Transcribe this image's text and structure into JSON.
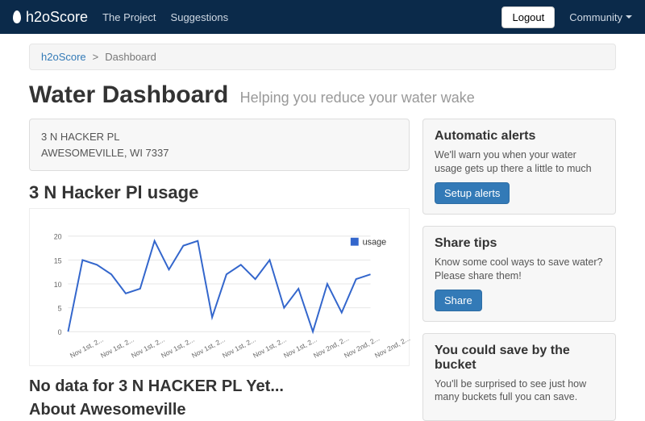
{
  "nav": {
    "brand": "h2oScore",
    "links": [
      "The Project",
      "Suggestions"
    ],
    "logout": "Logout",
    "community": "Community"
  },
  "breadcrumb": {
    "root": "h2oScore",
    "sep": ">",
    "current": "Dashboard"
  },
  "title": "Water Dashboard",
  "subtitle": "Helping you reduce your water wake",
  "address": {
    "line1": "3 N HACKER PL",
    "line2": "AWESOMEVILLE, WI 7337"
  },
  "usage_heading": "3 N Hacker Pl usage",
  "nodata_heading": "No data for 3 N HACKER PL Yet...",
  "about_heading": "About Awesomeville",
  "sidebar": {
    "alerts": {
      "title": "Automatic alerts",
      "body": "We'll warn you when your water usage gets up there a little to much",
      "button": "Setup alerts"
    },
    "share": {
      "title": "Share tips",
      "body": "Know some cool ways to save water? Please share them!",
      "button": "Share"
    },
    "bucket": {
      "title": "You could save by the bucket",
      "body": "You'll be surprised to see just how many buckets full you can save."
    }
  },
  "chart_data": {
    "type": "line",
    "title": "",
    "xlabel": "",
    "ylabel": "",
    "ylim": [
      0,
      20
    ],
    "yticks": [
      0,
      5,
      10,
      15,
      20
    ],
    "categories": [
      "Nov 1st, 2...",
      "Nov 1st, 2...",
      "Nov 1st, 2...",
      "Nov 1st, 2...",
      "Nov 1st, 2...",
      "Nov 1st, 2...",
      "Nov 1st, 2...",
      "Nov 1st, 2...",
      "Nov 2nd, 2...",
      "Nov 2nd, 2...",
      "Nov 2nd, 2..."
    ],
    "series": [
      {
        "name": "usage",
        "color": "#3366cc",
        "values": [
          0,
          15,
          14,
          12,
          8,
          9,
          19,
          13,
          18,
          19,
          3,
          12,
          14,
          11,
          15,
          5,
          9,
          0,
          10,
          4,
          11,
          12
        ]
      }
    ]
  }
}
